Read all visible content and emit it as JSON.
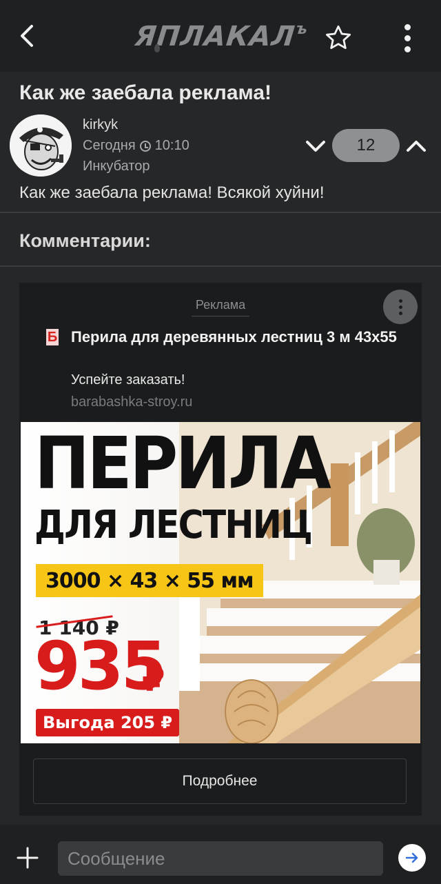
{
  "header": {
    "logo_text": "ЯПЛАКАЛ",
    "logo_hard_sign": "ъ",
    "icons": {
      "back": "chevron-left-icon",
      "favorite": "star-outline-icon",
      "menu": "kebab-menu-icon"
    }
  },
  "post": {
    "title": "Как же заебала реклама!",
    "author": "kirkyk",
    "date_label": "Сегодня",
    "time": "10:10",
    "section": "Инкубатор",
    "rating": "12",
    "body": "Как же заебала реклама! Всякой хуйни!"
  },
  "comments": {
    "heading": "Комментарии:"
  },
  "ad": {
    "label": "Реклама",
    "favicon_letter": "Б",
    "title": "Перила для деревянных лестниц 3 м 43x55",
    "subtitle": "Успейте заказать!",
    "domain": "barabashka-stroy.ru",
    "banner": {
      "headline": "ПЕРИЛА",
      "subheadline": "ДЛЯ ЛЕСТНИЦ",
      "size": "3000 × 43 × 55 мм",
      "old_price": "1 140 ₽",
      "price": "935",
      "price_currency": "₽",
      "savings": "Выгода 205 ₽"
    },
    "button_label": "Подробнее"
  },
  "composer": {
    "placeholder": "Сообщение",
    "value": ""
  },
  "colors": {
    "background": "#262728",
    "bar": "#1f2021",
    "ad_card": "#1b1c1d",
    "accent_red": "#d81c1c",
    "accent_yellow": "#f7c516",
    "rating_pill": "#8f9091"
  }
}
